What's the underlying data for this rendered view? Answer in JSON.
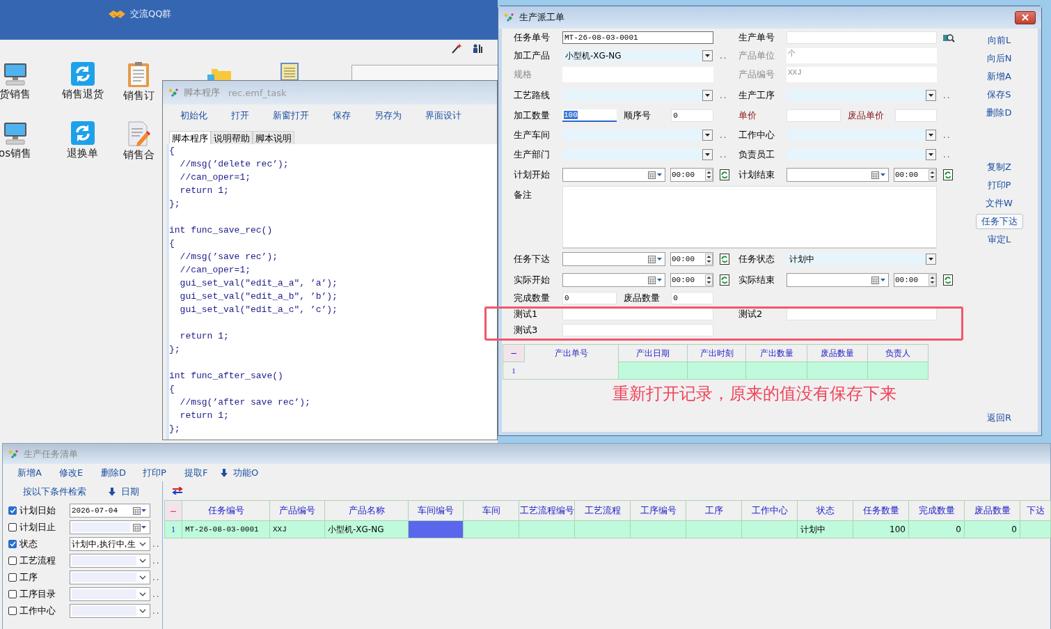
{
  "desktop": {
    "banner_label": "交流QQ群",
    "shortcuts": [
      {
        "label": "货销售",
        "kind": "monitor"
      },
      {
        "label": "销售退货",
        "kind": "sync"
      },
      {
        "label": "销售订",
        "kind": "clipboard"
      },
      {
        "label": "os销售",
        "kind": "monitor"
      },
      {
        "label": "退换单",
        "kind": "sync"
      },
      {
        "label": "销售合",
        "kind": "contract"
      }
    ]
  },
  "script_window": {
    "title": "脚本程序",
    "file": "rec.emf_task",
    "toolbar": [
      "初始化",
      "打开",
      "新窗打开",
      "保存",
      "另存为",
      "界面设计"
    ],
    "tabs": [
      {
        "label": "脚本程序",
        "selected": true
      },
      {
        "label": "说明帮助",
        "selected": false
      },
      {
        "label": "脚本说明",
        "selected": false
      }
    ],
    "code": "{\n  //msg(’delete rec’);\n  //can_oper=1;\n  return 1;\n};\n\nint func_save_rec()\n{\n  //msg(’save rec’);\n  //can_oper=1;\n  gui_set_val(″edit_a_a″, ’a’);\n  gui_set_val(″edit_a_b″, ’b’);\n  gui_set_val(″edit_a_c″, ’c’);\n\n  return 1;\n};\n\nint func_after_save()\n{\n  //msg(’after save rec’);\n  return 1;\n};"
  },
  "dispatch_window": {
    "title": "生产派工单",
    "form_rows": [
      {
        "left": {
          "label": "任务单号",
          "field": {
            "kind": "text",
            "value": "MT-26-08-03-0001"
          }
        },
        "right": {
          "label": "生产单号",
          "field": {
            "kind": "search"
          }
        }
      },
      {
        "left": {
          "label": "加工产品",
          "field": {
            "kind": "combo",
            "value": "小型机-XG-NG",
            "more": ".."
          }
        },
        "right": {
          "label": "产品单位",
          "muted": true,
          "field": {
            "kind": "readonly",
            "value": "个"
          }
        }
      },
      {
        "left": {
          "label": "规格",
          "muted": true,
          "field": {
            "kind": "readonly"
          }
        },
        "right": {
          "label": "产品编号",
          "muted": true,
          "field": {
            "kind": "readonly",
            "value": "XXJ"
          }
        }
      },
      {
        "left": {
          "label": "工艺路线",
          "field": {
            "kind": "combo",
            "more": ".."
          }
        },
        "right": {
          "label": "生产工序",
          "field": {
            "kind": "combo",
            "more": ".."
          }
        }
      },
      {
        "left": {
          "label": "加工数量",
          "field": {
            "kind": "pair",
            "value": "100",
            "focused": true,
            "sub_label": "顺序号",
            "sub_value": "0"
          }
        },
        "right": {
          "label": "单价",
          "required": true,
          "field": {
            "kind": "pair",
            "sub_label": "废品单价",
            "sub_required": true
          }
        }
      },
      {
        "left": {
          "label": "生产车间",
          "field": {
            "kind": "combo",
            "more": ".."
          }
        },
        "right": {
          "label": "工作中心",
          "field": {
            "kind": "combo",
            "more": ".."
          }
        }
      },
      {
        "left": {
          "label": "生产部门",
          "field": {
            "kind": "combo",
            "more": ".."
          }
        },
        "right": {
          "label": "负责员工",
          "field": {
            "kind": "combo",
            "more": ".."
          }
        }
      },
      {
        "left": {
          "label": "计划开始",
          "field": {
            "kind": "datetime",
            "time": "00:00"
          }
        },
        "right": {
          "label": "计划结束",
          "field": {
            "kind": "datetime",
            "time": "00:00"
          }
        }
      },
      {
        "left": {
          "label": "备注",
          "field": {
            "kind": "memo"
          }
        }
      },
      {
        "left": {
          "label": "任务下达",
          "field": {
            "kind": "datetime",
            "time": "00:00"
          }
        },
        "right": {
          "label": "任务状态",
          "field": {
            "kind": "combo",
            "value": "计划中"
          }
        }
      },
      {
        "left": {
          "label": "实际开始",
          "field": {
            "kind": "datetime",
            "time": "00:00"
          }
        },
        "right": {
          "label": "实际结束",
          "field": {
            "kind": "datetime",
            "time": "00:00"
          }
        }
      },
      {
        "left": {
          "label": "完成数量",
          "field": {
            "kind": "pair",
            "value": "0",
            "sub_label": "废品数量",
            "sub_value": "0"
          }
        }
      },
      {
        "left": {
          "label": "测试1",
          "field": {
            "kind": "plain"
          }
        },
        "right": {
          "label": "测试2",
          "field": {
            "kind": "plain"
          }
        }
      },
      {
        "left": {
          "label": "测试3",
          "field": {
            "kind": "plain"
          }
        }
      }
    ],
    "actions": [
      [
        {
          "label": "向前L",
          "kind": "link"
        },
        {
          "label": "向后N",
          "kind": "link"
        },
        {
          "label": "新增A",
          "kind": "link"
        },
        {
          "label": "保存S",
          "kind": "link"
        },
        {
          "label": "删除D",
          "kind": "link"
        }
      ],
      [
        {
          "label": "复制Z",
          "kind": "link"
        },
        {
          "label": "打印P",
          "kind": "link"
        },
        {
          "label": "文件W",
          "kind": "link"
        },
        {
          "label": "任务下达",
          "kind": "button"
        },
        {
          "label": "审定L",
          "kind": "link"
        }
      ],
      [
        {
          "label": "返回R",
          "kind": "link"
        }
      ]
    ],
    "output_table": {
      "columns": [
        "−",
        "产出单号",
        "产出日期",
        "产出时刻",
        "产出数量",
        "废品数量",
        "负责人"
      ],
      "rows": [
        {
          "number": "1"
        }
      ]
    }
  },
  "task_list_window": {
    "title": "生产任务清单",
    "toolbar": [
      {
        "label": "新增A",
        "kind": "link"
      },
      {
        "label": "修改E",
        "kind": "link"
      },
      {
        "label": "删除D",
        "kind": "link"
      },
      {
        "label": "打印P",
        "kind": "link"
      },
      {
        "label": "提取F",
        "kind": "link"
      },
      {
        "label": "功能O",
        "kind": "menu"
      }
    ],
    "filter": {
      "title": "按以下条件检索",
      "sort": "日期",
      "rows": [
        {
          "label": "计划日始",
          "checked": true,
          "kind": "date",
          "value": "2026-07-04"
        },
        {
          "label": "计划日止",
          "checked": false,
          "kind": "date"
        },
        {
          "label": "状态",
          "checked": true,
          "kind": "combo",
          "value": "计划中,执行中,生",
          "more": ".."
        },
        {
          "label": "工艺流程",
          "checked": false,
          "kind": "combo",
          "more": ".."
        },
        {
          "label": "工序",
          "checked": false,
          "kind": "combo",
          "more": ".."
        },
        {
          "label": "工序目录",
          "checked": false,
          "kind": "combo",
          "more": ".."
        },
        {
          "label": "工作中心",
          "checked": false,
          "kind": "combo",
          "more": ".."
        }
      ]
    },
    "grid": {
      "columns": [
        {
          "label": "−",
          "kind": "marker"
        },
        {
          "label": "任务编号",
          "kind": "text"
        },
        {
          "label": "产品编号",
          "kind": "text"
        },
        {
          "label": "产品名称",
          "kind": "text"
        },
        {
          "label": "车间编号",
          "kind": "text"
        },
        {
          "label": "车间",
          "kind": "text"
        },
        {
          "label": "工艺流程编号",
          "kind": "text"
        },
        {
          "label": "工艺流程",
          "kind": "text"
        },
        {
          "label": "工序编号",
          "kind": "text"
        },
        {
          "label": "工序",
          "kind": "text"
        },
        {
          "label": "工作中心",
          "kind": "text"
        },
        {
          "label": "状态",
          "kind": "text"
        },
        {
          "label": "任务数量",
          "kind": "number"
        },
        {
          "label": "完成数量",
          "kind": "number"
        },
        {
          "label": "废品数量",
          "kind": "number"
        },
        {
          "label": "下达",
          "kind": "text"
        }
      ],
      "rows": [
        {
          "cells": [
            {
              "text": "1"
            },
            {
              "text": "MT-26-08-03-0001",
              "selected": false
            },
            {
              "text": "XXJ",
              "selected": false
            },
            {
              "text": "小型机-XG-NG",
              "selected": false
            },
            {
              "selected": true
            },
            {
              "selected": false
            },
            {
              "selected": false
            },
            {
              "selected": false
            },
            {
              "selected": false
            },
            {
              "selected": false
            },
            {
              "selected": false
            },
            {
              "text": "计划中",
              "selected": false
            },
            {
              "text": "100",
              "selected": false
            },
            {
              "text": "0",
              "selected": false
            },
            {
              "text": "0",
              "selected": false
            },
            {
              "selected": false
            }
          ]
        }
      ]
    }
  },
  "annotation": {
    "text": "重新打开记录，原来的值没有保存下来"
  }
}
